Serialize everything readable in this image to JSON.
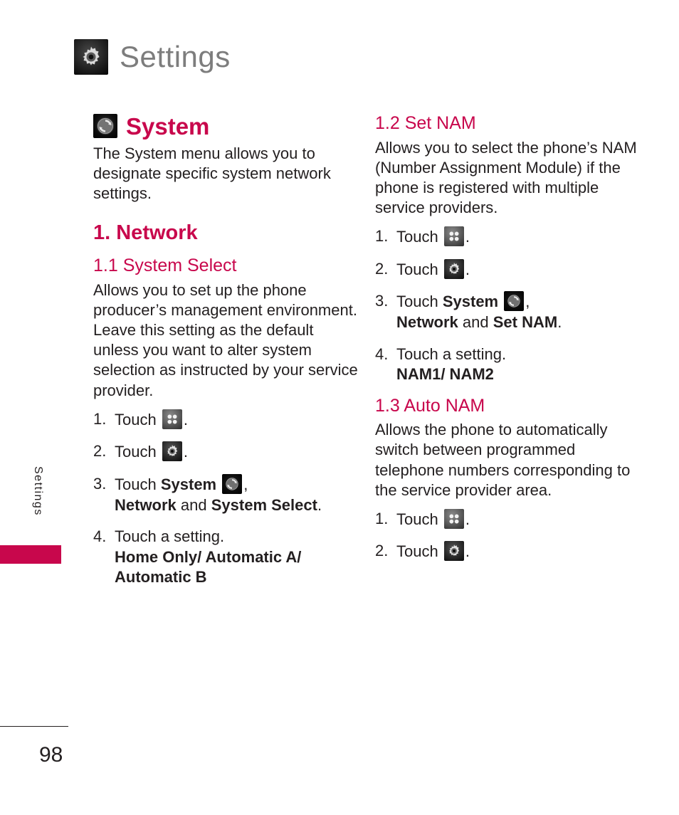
{
  "page": {
    "header_title": "Settings",
    "header_icon": "gear-icon",
    "side_tab_label": "Settings",
    "page_number": "98",
    "accent_color": "#c8074c",
    "text_color": "#231f20",
    "header_title_color": "#7d7d7d"
  },
  "left_column": {
    "section": {
      "icon": "system-refresh-icon",
      "title": "System",
      "intro": "The System menu allows you to designate specific system network settings."
    },
    "heading": "1. Network",
    "subsection": {
      "heading": "1.1 System Select",
      "body": "Allows you to set up the phone producer’s management environment. Leave this setting as the default unless you want to alter system selection as instructed by your service provider.",
      "steps": [
        {
          "num": "1.",
          "text_before": "Touch",
          "icon": "grid-4dot-icon",
          "text_after": "."
        },
        {
          "num": "2.",
          "text_before": "Touch",
          "icon": "gear-icon",
          "text_after": "."
        },
        {
          "num": "3.",
          "text_before": "Touch",
          "bold_before": "System",
          "icon": "system-refresh-icon",
          "text_after": ",",
          "line2_bold_a": "Network",
          "line2_plain": " and ",
          "line2_bold_b": "System Select",
          "line2_end": "."
        },
        {
          "num": "4.",
          "text_before": "Touch a setting.",
          "options_line1": "Home Only/ Automatic A/",
          "options_line2": "Automatic B"
        }
      ]
    }
  },
  "right_column": {
    "subsection_2": {
      "heading": "1.2 Set NAM",
      "body": "Allows you to select the phone’s NAM (Number Assignment Module) if the phone is registered with multiple service providers.",
      "steps": [
        {
          "num": "1.",
          "text_before": "Touch",
          "icon": "grid-4dot-icon",
          "text_after": "."
        },
        {
          "num": "2.",
          "text_before": "Touch",
          "icon": "gear-icon",
          "text_after": "."
        },
        {
          "num": "3.",
          "text_before": "Touch",
          "bold_before": "System",
          "icon": "system-refresh-icon",
          "text_after": ",",
          "line2_bold_a": "Network",
          "line2_plain": " and ",
          "line2_bold_b": "Set NAM",
          "line2_end": "."
        },
        {
          "num": "4.",
          "text_before": "Touch a setting.",
          "options_line1": "NAM1/ NAM2"
        }
      ]
    },
    "subsection_3": {
      "heading": "1.3 Auto NAM",
      "body": "Allows the phone to automatically switch between programmed telephone numbers corresponding to the service provider area.",
      "steps": [
        {
          "num": "1.",
          "text_before": "Touch",
          "icon": "grid-4dot-icon",
          "text_after": "."
        },
        {
          "num": "2.",
          "text_before": "Touch",
          "icon": "gear-icon",
          "text_after": "."
        }
      ]
    }
  }
}
